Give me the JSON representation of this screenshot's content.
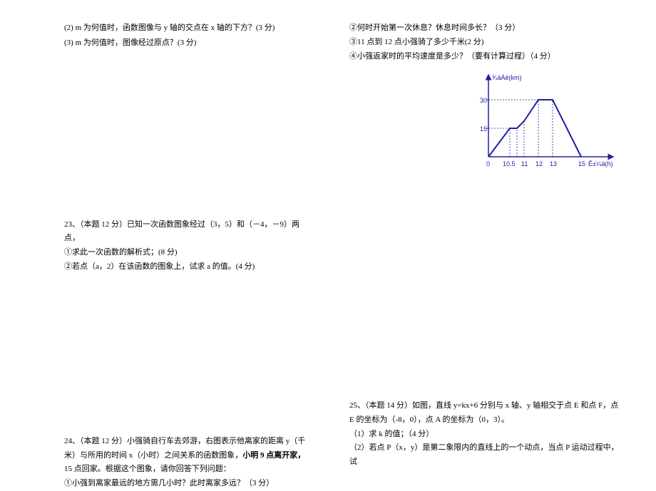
{
  "q22": {
    "sub2": "(2) m 为何值时，函数图像与 y 轴的交点在 x 轴的下方？(3 分)",
    "sub3": "(3) m 为何值时，图像经过原点？(3 分)"
  },
  "q24_notes": {
    "n2": "②何时开始第一次休息？休息时间多长？（3 分）",
    "n3": "③11 点到 12 点小强骑了多少千米(2 分)",
    "n4": "④小强返家时的平均速度是多少？（要有计算过程）（4 分）"
  },
  "q23": {
    "header": "23、（本题 12 分）已知一次函数图象经过（3，5）和（－4，－9）两点，",
    "sub1": "①求此一次函数的解析式；(8 分)",
    "sub2": "②若点（a，2）在该函数的图象上，试求 a 的值。(4 分)"
  },
  "q24": {
    "header_a": "24、（本题 12 分）小强骑自行车去郊游，右图表示他离家的距离 y（千米）与所用的时间 x（小时）之间关系的函数图象，",
    "bold": "小明 9 点离开家，",
    "header_b": "15 点回家。根据这个图象，请你回答下列问题：",
    "sub1": "①小强到离家最远的地方需几小时？此时离家多远？（3 分）"
  },
  "q25": {
    "header": "25、（本题 14 分）如图，直线 y=kx+6 分别与 x 轴、y 轴相交于点 E 和点 F，点 E 的坐标为（-8，0），点 A 的坐标为（0，3）。",
    "sub1": "（1）求 k 的值；（4 分）",
    "sub2": "（2）若点 P（x，y）是第二象限内的直线上的一个动点，当点 P 运动过程中，试"
  },
  "chart_data": {
    "type": "line",
    "title": "",
    "xlabel": "Ê±¼ä(h)",
    "ylabel": "¾àÀë(km)",
    "x_ticks": [
      0,
      10.5,
      11,
      12,
      13,
      15
    ],
    "y_ticks": [
      15,
      30
    ],
    "points": [
      {
        "x": 0,
        "y": 0
      },
      {
        "x": 10,
        "y": 15
      },
      {
        "x": 10.5,
        "y": 15
      },
      {
        "x": 11,
        "y": 20
      },
      {
        "x": 12,
        "y": 30
      },
      {
        "x": 13,
        "y": 30
      },
      {
        "x": 15,
        "y": 0
      }
    ],
    "xlim": [
      0,
      16
    ],
    "ylim": [
      0,
      35
    ]
  }
}
